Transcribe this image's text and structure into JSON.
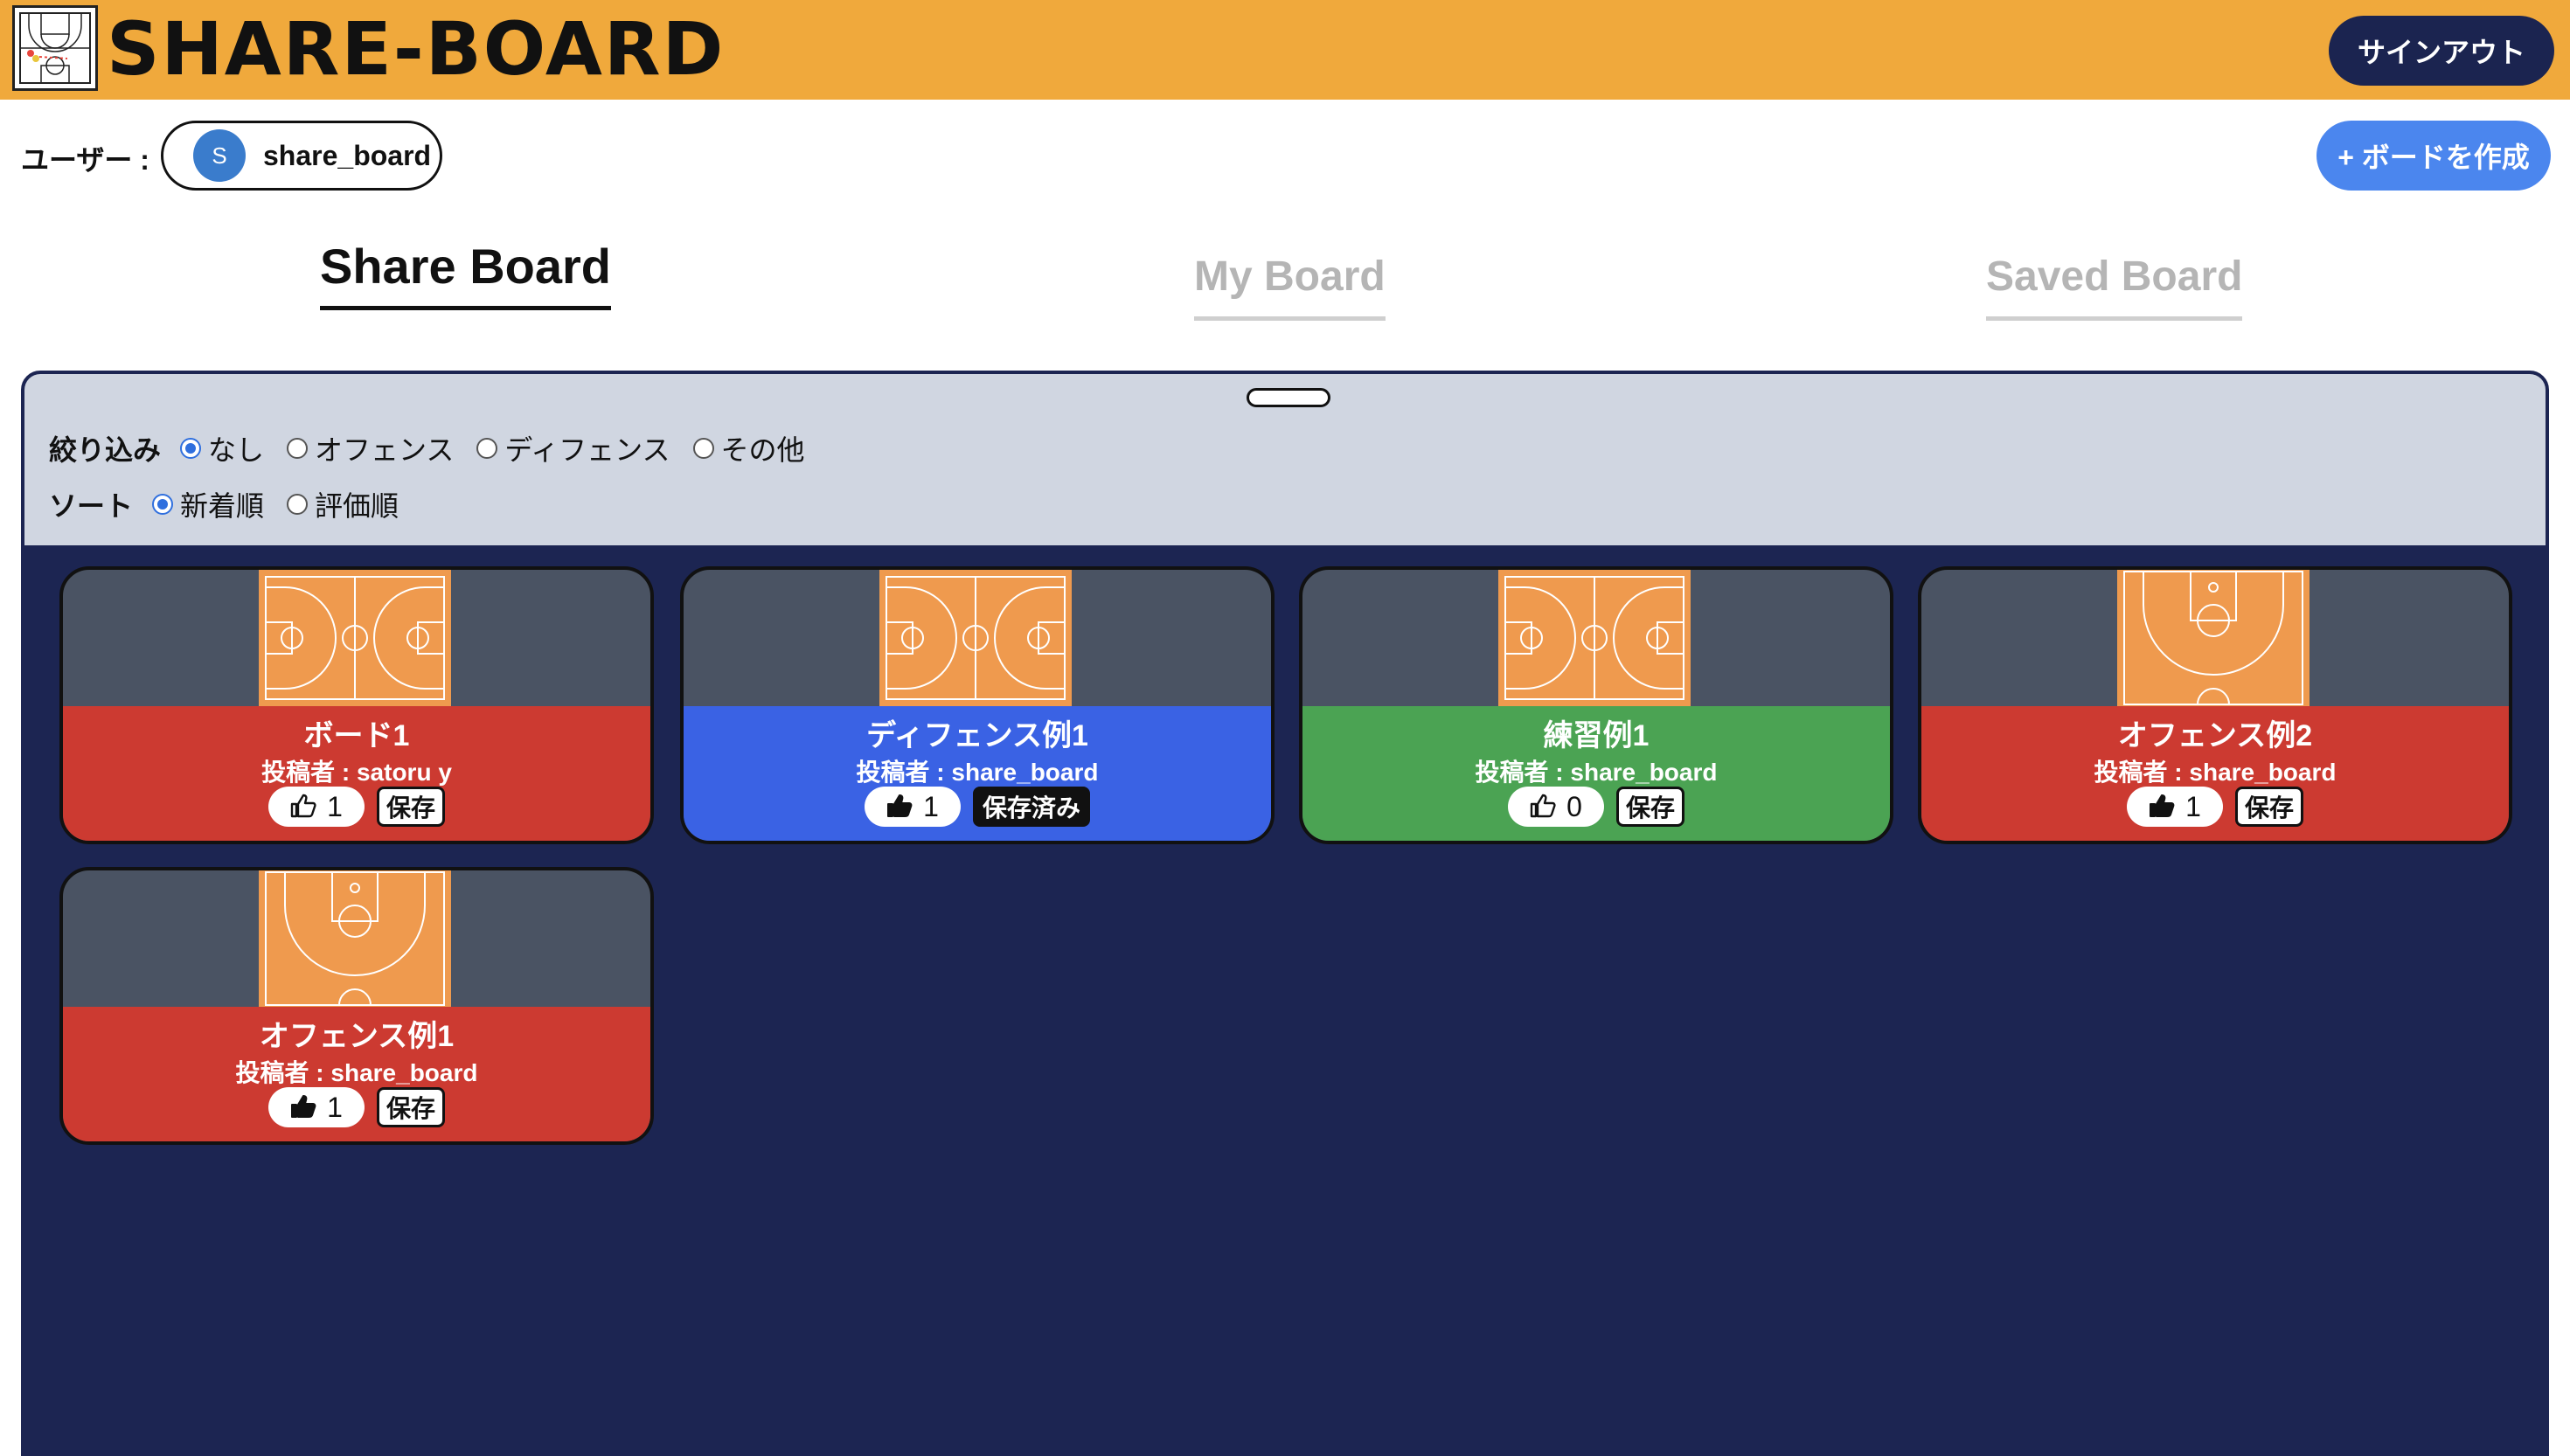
{
  "header": {
    "title": "SHARE-BOARD",
    "signout_label": "サインアウト"
  },
  "user": {
    "label": "ユーザー :",
    "initial": "S",
    "name": "share_board"
  },
  "create_label": "+ ボードを作成",
  "tabs": [
    {
      "label": "Share Board",
      "active": true
    },
    {
      "label": "My Board",
      "active": false
    },
    {
      "label": "Saved Board",
      "active": false
    }
  ],
  "filter": {
    "label": "絞り込み",
    "options": [
      "なし",
      "オフェンス",
      "ディフェンス",
      "その他"
    ],
    "selected": "なし"
  },
  "sort": {
    "label": "ソート",
    "options": [
      "新着順",
      "評価順"
    ],
    "selected": "新着順"
  },
  "colors": {
    "offense": "#cc3a31",
    "defense": "#3a62e4",
    "practice": "#4ba353",
    "panel": "#1c2552",
    "header": "#f0a93c"
  },
  "boards": [
    {
      "title": "ボード1",
      "author": "投稿者 : satoru y",
      "likes": "1",
      "liked": false,
      "save_label": "保存",
      "saved": false,
      "category": "offense",
      "court": "full"
    },
    {
      "title": "ディフェンス例1",
      "author": "投稿者 : share_board",
      "likes": "1",
      "liked": true,
      "save_label": "保存済み",
      "saved": true,
      "category": "defense",
      "court": "full"
    },
    {
      "title": "練習例1",
      "author": "投稿者 : share_board",
      "likes": "0",
      "liked": false,
      "save_label": "保存",
      "saved": false,
      "category": "practice",
      "court": "full"
    },
    {
      "title": "オフェンス例2",
      "author": "投稿者 : share_board",
      "likes": "1",
      "liked": true,
      "save_label": "保存",
      "saved": false,
      "category": "offense",
      "court": "half"
    },
    {
      "title": "オフェンス例1",
      "author": "投稿者 : share_board",
      "likes": "1",
      "liked": true,
      "save_label": "保存",
      "saved": false,
      "category": "offense",
      "court": "half"
    }
  ]
}
